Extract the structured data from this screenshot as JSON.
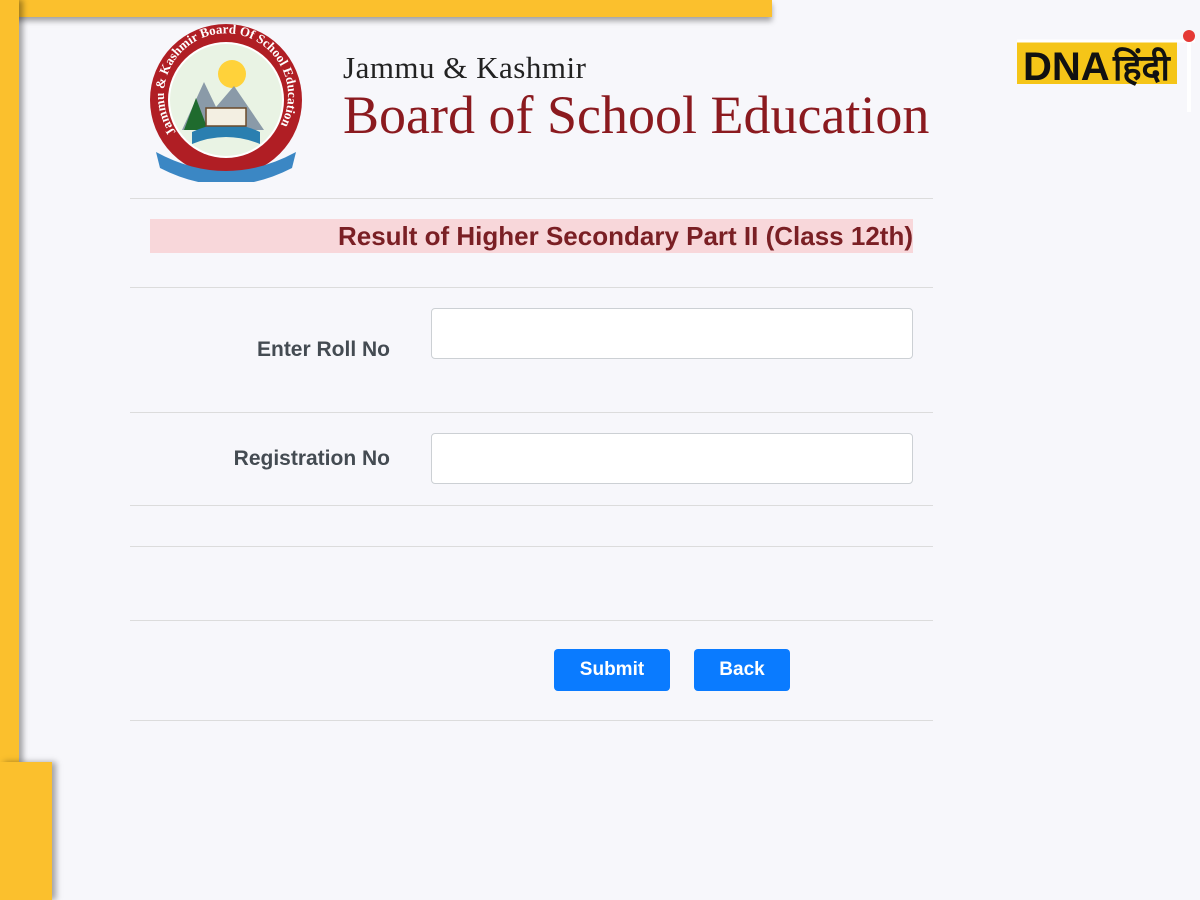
{
  "branding": {
    "org_line1": "Jammu & Kashmir",
    "org_line2": "Board of School Education",
    "seal_ring_text": "Jammu & Kashmir Board Of School Education",
    "watermark_dna": "DNA",
    "watermark_hindi": "हिंदी",
    "colors": {
      "brand_maroon": "#8b1a1f",
      "frame_yellow": "#fbc02d",
      "button_blue": "#0a7bff",
      "title_band": "#f8d7da"
    }
  },
  "form": {
    "title": "Result of Higher Secondary Part II (Class 12th)",
    "roll_label": "Enter Roll No",
    "roll_value": "",
    "registration_label": "Registration No",
    "registration_value": ""
  },
  "actions": {
    "submit_label": "Submit",
    "back_label": "Back"
  }
}
